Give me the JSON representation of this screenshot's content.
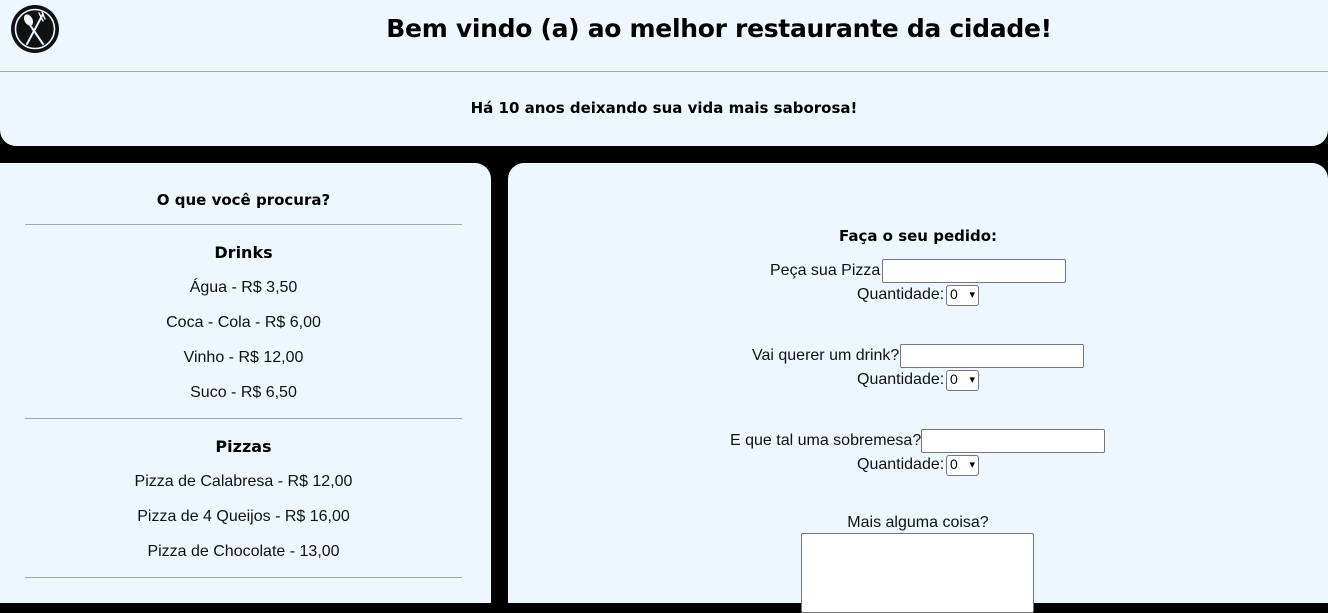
{
  "header": {
    "logo_icon": "spoon-fork-icon",
    "title": "Bem vindo (a) ao melhor restaurante da cidade!",
    "tagline": "Há 10 anos deixando sua vida mais saborosa!"
  },
  "menu": {
    "question": "O que você procura?",
    "sections": [
      {
        "title": "Drinks",
        "items": [
          "Água - R$ 3,50",
          "Coca - Cola - R$ 6,00",
          "Vinho - R$ 12,00",
          "Suco - R$ 6,50"
        ]
      },
      {
        "title": "Pizzas",
        "items": [
          "Pizza de Calabresa - R$ 12,00",
          "Pizza de 4 Queijos - R$ 16,00",
          "Pizza de Chocolate - 13,00"
        ]
      }
    ]
  },
  "order": {
    "title": "Faça o seu pedido:",
    "pizza_label": "Peça sua Pizza",
    "pizza_value": "",
    "drink_label": "Vai querer um drink?",
    "drink_value": "",
    "dessert_label": "E que tal uma sobremesa?",
    "dessert_value": "",
    "quantity_label": "Quantidade:",
    "quantity_values": [
      "0",
      "0",
      "0"
    ],
    "more_label": "Mais alguma coisa?",
    "more_value": ""
  }
}
